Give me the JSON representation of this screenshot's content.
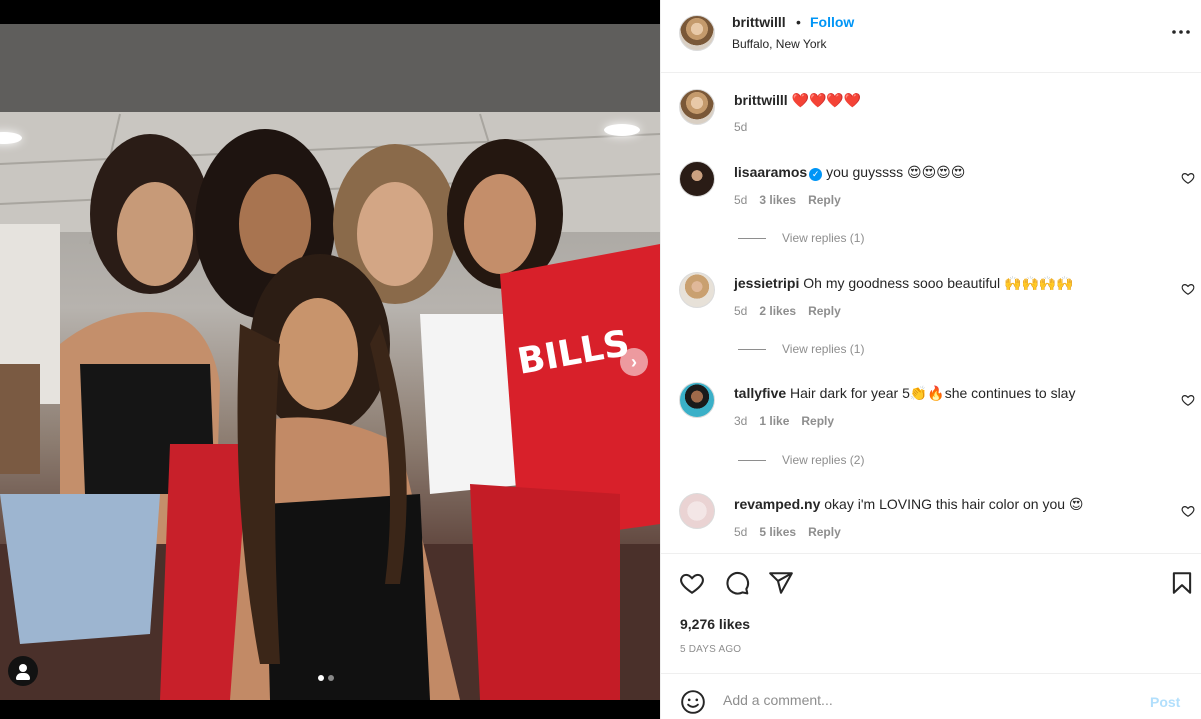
{
  "post": {
    "username": "brittwilll",
    "separator": "•",
    "follow_label": "Follow",
    "location": "Buffalo, New York",
    "caption_user": "brittwilll",
    "caption_text": "❤️❤️❤️❤️",
    "caption_age": "5d",
    "likes": "9,276 likes",
    "posted": "5 DAYS AGO"
  },
  "comments": [
    {
      "user": "lisaaramos",
      "verified": true,
      "text": "you guyssss 😍😍😍😍",
      "age": "5d",
      "likes": "3 likes",
      "reply": "Reply",
      "view_replies": "View replies (1)"
    },
    {
      "user": "jessietripi",
      "verified": false,
      "text": "Oh my goodness sooo beautiful 🙌🙌🙌🙌",
      "age": "5d",
      "likes": "2 likes",
      "reply": "Reply",
      "view_replies": "View replies (1)"
    },
    {
      "user": "tallyfive",
      "verified": false,
      "text": "Hair dark for year 5👏🔥she continues to slay",
      "age": "3d",
      "likes": "1 like",
      "reply": "Reply",
      "view_replies": "View replies (2)"
    },
    {
      "user": "revamped.ny",
      "verified": false,
      "text": "okay i'm LOVING this hair color on you 😍",
      "age": "5d",
      "likes": "5 likes",
      "reply": "Reply",
      "view_replies": ""
    }
  ],
  "composer": {
    "placeholder": "Add a comment...",
    "post_label": "Post"
  },
  "colors": {
    "accent": "#0095f6",
    "post_disabled": "#b2dffc",
    "muted": "#8e8e8e"
  },
  "icons": [
    "more-options-icon",
    "like-icon",
    "comment-icon",
    "share-icon",
    "save-icon",
    "emoji-icon",
    "next-arrow-icon",
    "user-tag-icon",
    "verified-icon"
  ]
}
